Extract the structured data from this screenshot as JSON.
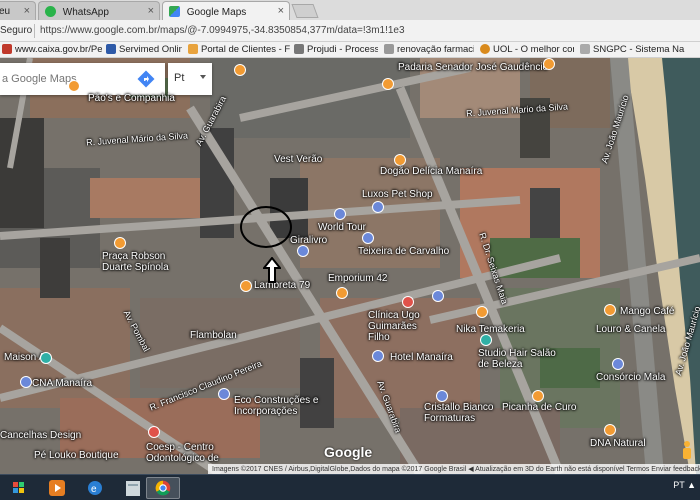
{
  "browser": {
    "tabs": [
      {
        "label": "eu",
        "active": false
      },
      {
        "label": "WhatsApp",
        "active": false
      },
      {
        "label": "Google Maps",
        "active": true
      }
    ],
    "secure_label": "Seguro",
    "url": "https://www.google.com.br/maps/@-7.0994975,-34.8350854,377m/data=!3m1!1e3",
    "bookmarks": [
      "www.caixa.gov.br/Pe",
      "Servimed Online",
      "Portal de Clientes - F",
      "Projudi - Processo Ele",
      "renovação farmacio",
      "UOL - O melhor cont",
      "SNGPC - Sistema Na"
    ]
  },
  "map": {
    "search_placeholder": "a Google Maps",
    "language": "Pt",
    "annotation": {
      "type": "circle-with-arrow"
    },
    "places": [
      "Padaria Senador José Gaudêncio",
      "Pão's e Companhia",
      "Vest Verão",
      "Dogão Delícia Manaíra",
      "Luxos Pet Shop",
      "World Tour",
      "Giralivro",
      "Teixeira de Carvalho",
      "Praça Robson Duarte Spínola",
      "Emporium 42",
      "Lambreta 79",
      "Flambolan",
      "Clínica Ugo Guimarães Filho",
      "Nika Temakeria",
      "Mango Café",
      "Louro & Canela",
      "Maison A",
      "CNA Manaíra",
      "Hotel Manaíra",
      "Studio Hair Salão de Beleza",
      "Consórcio Mala",
      "Eco Construções e Incorporações",
      "Cristallo Bianco Formaturas",
      "Picanha de Curo",
      "Cancelhas Design",
      "Coesp - Centro Odontológico de",
      "Pé Louko Boutique",
      "DNA Natural"
    ],
    "roads": [
      "R. Juvenal Mário da Silva",
      "R. Juvenal Mario da Silva",
      "Av. Guarabira",
      "Av. João Maurício",
      "R. Dr. Seixas Maia",
      "Av. Pombal",
      "R. Francisco Claudino Pereira"
    ],
    "attribution": "Imagens ©2017 CNES / Airbus,DigitalGlobe,Dados do mapa ©2017 Google    Brasil    ◀ Atualização em 3D do Earth não está disponível    Termos    Enviar feedback",
    "logo": "Google"
  },
  "taskbar": {
    "lang": "PT"
  }
}
